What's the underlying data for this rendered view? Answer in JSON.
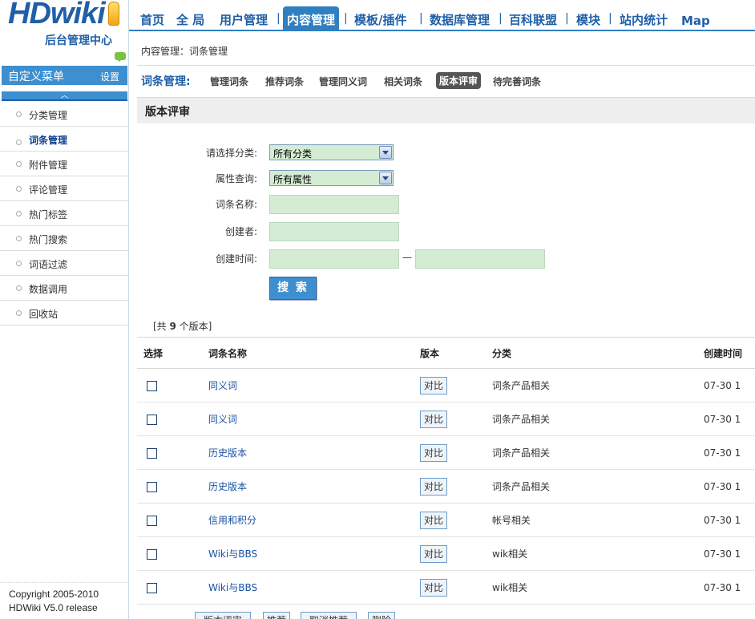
{
  "logo": {
    "word": "HDwiki",
    "subtitle": "后台管理中心"
  },
  "sidebar": {
    "menu_title": "自定义菜单",
    "menu_settings": "设置",
    "collapse_glyph": "︿",
    "items": [
      {
        "label": "分类管理"
      },
      {
        "label": "词条管理"
      },
      {
        "label": "附件管理"
      },
      {
        "label": "评论管理"
      },
      {
        "label": "热门标签"
      },
      {
        "label": "热门搜索"
      },
      {
        "label": "词语过滤"
      },
      {
        "label": "数据调用"
      },
      {
        "label": "回收站"
      }
    ],
    "active_index": 1,
    "copyright_line1": "Copyright 2005-2010",
    "copyright_line2": "HDWiki V5.0 release"
  },
  "topnav": {
    "items": [
      {
        "label": "首页"
      },
      {
        "label": "全 局"
      },
      {
        "label": "用户管理"
      },
      {
        "label": "内容管理"
      },
      {
        "label": "模板/插件"
      },
      {
        "label": "数据库管理"
      },
      {
        "label": "百科联盟"
      },
      {
        "label": "模块"
      },
      {
        "label": "站内统计"
      },
      {
        "label": "Map"
      }
    ],
    "separator": "|"
  },
  "main": {
    "breadcrumb": "内容管理：词条管理",
    "subnav_title": "词条管理:",
    "subnav_items": [
      {
        "label": "管理词条"
      },
      {
        "label": "推荐词条"
      },
      {
        "label": "管理同义词"
      },
      {
        "label": "相关词条"
      },
      {
        "label": "版本评审"
      },
      {
        "label": "待完善词条"
      }
    ],
    "section_title": "版本评审",
    "form": {
      "category_label": "请选择分类:",
      "category_value": "所有分类",
      "attribute_label": "属性查询:",
      "attribute_value": "所有属性",
      "title_label": "词条名称:",
      "creator_label": "创建者:",
      "time_label": "创建时间:",
      "time_dash": "—",
      "search_button": "搜 索"
    },
    "count_prefix": "[共 ",
    "count_value": "9",
    "count_suffix": " 个版本]",
    "table": {
      "headers": {
        "select": "选择",
        "name": "词条名称",
        "version": "版本",
        "category": "分类",
        "time": "创建时间"
      },
      "compare_label": "对比",
      "rows": [
        {
          "name": "同义词",
          "category": "词条产品相关",
          "time": "07-30 1"
        },
        {
          "name": "同义词",
          "category": "词条产品相关",
          "time": "07-30 1"
        },
        {
          "name": "历史版本",
          "category": "词条产品相关",
          "time": "07-30 1"
        },
        {
          "name": "历史版本",
          "category": "词条产品相关",
          "time": "07-30 1"
        },
        {
          "name": "信用和积分",
          "category": "帐号相关",
          "time": "07-30 1"
        },
        {
          "name": "Wiki与BBS",
          "category": "wik相关",
          "time": "07-30 1"
        },
        {
          "name": "Wiki与BBS",
          "category": "wik相关",
          "time": "07-30 1"
        }
      ]
    },
    "bottom_actions": [
      {
        "label": "版本评审"
      },
      {
        "label": "推荐"
      },
      {
        "label": "取消推荐"
      },
      {
        "label": "删除"
      }
    ]
  },
  "colors": {
    "brand_blue": "#1f5fa8",
    "accent_blue": "#3d8fd0",
    "input_green": "#d3ecd3"
  }
}
